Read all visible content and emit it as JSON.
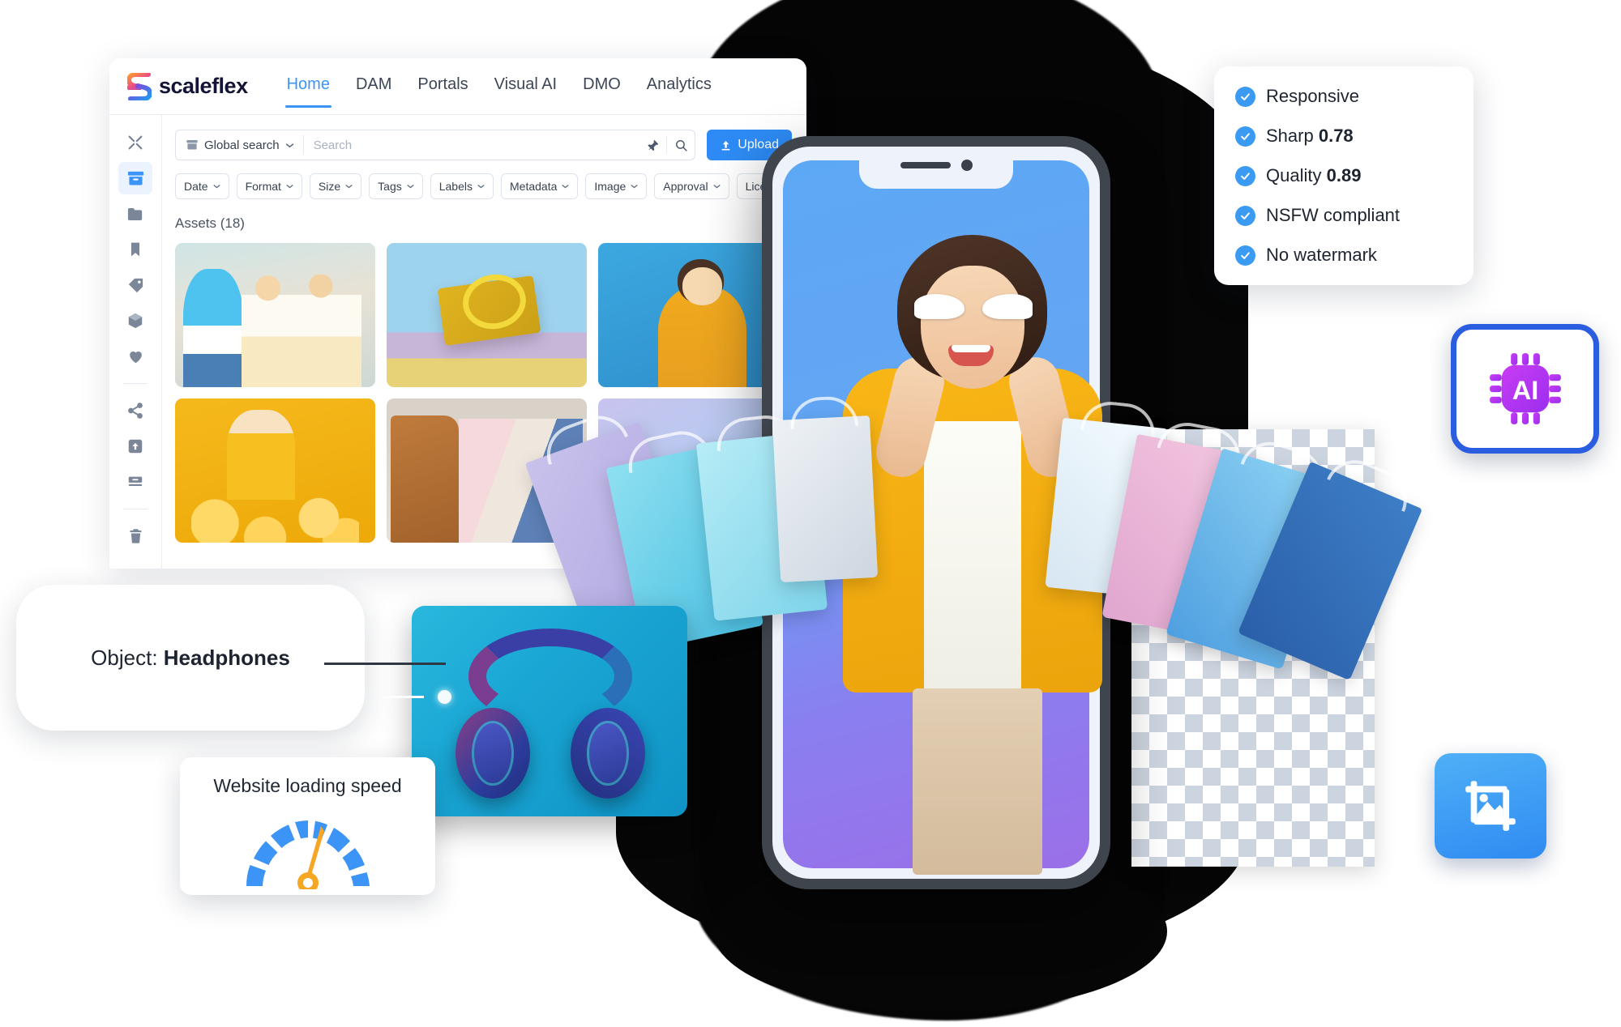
{
  "window": {
    "brand": "scaleflex",
    "brand_logo_icon": "scaleflex-s-logo-icon",
    "nav": [
      {
        "label": "Home",
        "active": true
      },
      {
        "label": "DAM",
        "active": false
      },
      {
        "label": "Portals",
        "active": false
      },
      {
        "label": "Visual AI",
        "active": false
      },
      {
        "label": "DMO",
        "active": false
      },
      {
        "label": "Analytics",
        "active": false
      }
    ]
  },
  "rail": {
    "items": [
      {
        "icon": "shuffle-icon",
        "name": "shuffle",
        "selected": false
      },
      {
        "icon": "archive-box-icon",
        "name": "assets",
        "selected": true
      },
      {
        "icon": "folder-icon",
        "name": "folders",
        "selected": false
      },
      {
        "icon": "bookmark-icon",
        "name": "bookmarks",
        "selected": false
      },
      {
        "icon": "tags-icon",
        "name": "tags",
        "selected": false
      },
      {
        "icon": "cube-icon",
        "name": "products",
        "selected": false
      },
      {
        "icon": "heart-icon",
        "name": "favorites",
        "selected": false
      },
      {
        "icon": "share-icon",
        "name": "share",
        "selected": false
      },
      {
        "icon": "upload-box-icon",
        "name": "uploads",
        "selected": false
      },
      {
        "icon": "archive-stack-icon",
        "name": "archive",
        "selected": false
      },
      {
        "icon": "trash-icon",
        "name": "trash",
        "selected": false
      }
    ]
  },
  "search": {
    "scope_label": "Global search",
    "scope_icon": "archive-box-icon",
    "chevron_icon": "chevron-down-icon",
    "placeholder": "Search",
    "value": "",
    "pin_icon": "pin-icon",
    "search_icon": "search-icon",
    "upload_label": "Upload",
    "upload_icon": "upload-arrow-icon"
  },
  "filters": [
    {
      "label": "Date"
    },
    {
      "label": "Format"
    },
    {
      "label": "Size"
    },
    {
      "label": "Tags"
    },
    {
      "label": "Labels"
    },
    {
      "label": "Metadata"
    },
    {
      "label": "Image"
    },
    {
      "label": "Approval"
    },
    {
      "label": "License expiry"
    }
  ],
  "assets": {
    "heading": "Assets (18)",
    "count": 18,
    "thumbnails": [
      {
        "alt": "three friends in sunglasses on a street",
        "art": "t-friends"
      },
      {
        "alt": "yellow quilted chain handbag on blue backdrop",
        "art": "t-bag"
      },
      {
        "alt": "woman in yellow top taking a selfie on blue backdrop",
        "art": "t-selfie"
      },
      {
        "alt": "man in yellow shirt with yellow balloons",
        "art": "t-balloons"
      },
      {
        "alt": "rack of clothes with denim and pink garments",
        "art": "t-clothes"
      },
      {
        "alt": "lavender blue gradient asset",
        "art": "t-lav"
      }
    ]
  },
  "phone": {
    "notch_speaker_icon": "speaker-bar-icon",
    "notch_camera_icon": "front-camera-icon",
    "screen_alt": "smiling woman in yellow blazer and white sunglasses holding many shopping bags"
  },
  "badges": {
    "check_icon": "check-circle-icon",
    "items": [
      {
        "label": "Responsive",
        "value": ""
      },
      {
        "label": "Sharp",
        "value": "0.78"
      },
      {
        "label": "Quality",
        "value": "0.89"
      },
      {
        "label": "NSFW compliant",
        "value": ""
      },
      {
        "label": "No watermark",
        "value": ""
      }
    ]
  },
  "ai_card": {
    "icon": "ai-chip-icon",
    "label": "AI"
  },
  "crop_card": {
    "icon": "image-crop-icon"
  },
  "headphones_card": {
    "alt": "blue and purple over-ear headphones on cyan background",
    "hotspot_icon": "detection-point-icon"
  },
  "object_label": {
    "prefix": "Object:",
    "value": "Headphones"
  },
  "speed_card": {
    "title": "Website loading speed",
    "gauge_icon": "speedometer-icon"
  },
  "colors": {
    "accent_blue": "#2e8bf5",
    "nav_active": "#3b94f6",
    "badge_blue": "#3b9bf3",
    "ai_purple": "#b832f0",
    "ai_border": "#2b5de0",
    "gauge_blue": "#3b94f6",
    "gauge_needle": "#f5a623",
    "jacket_yellow": "#f9b616",
    "text_dark": "#1d2430"
  }
}
